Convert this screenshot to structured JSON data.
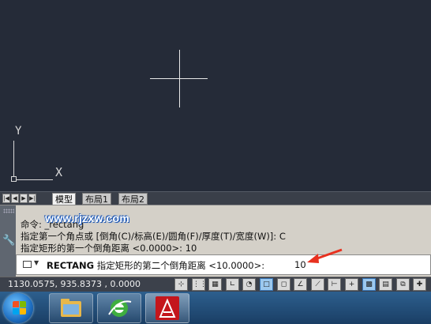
{
  "drawing": {
    "ucs_y_label": "Y",
    "ucs_x_label": "X"
  },
  "layout_tabs": {
    "nav_first": "|◀",
    "nav_prev": "◀",
    "nav_next": "▶",
    "nav_last": "▶|",
    "tabs": [
      {
        "label": "模型",
        "active": true
      },
      {
        "label": "布局1",
        "active": false
      },
      {
        "label": "布局2",
        "active": false
      }
    ]
  },
  "command_window": {
    "watermark": "www.rjzxw.com",
    "history": [
      "命令: _rectang",
      "指定第一个角点或 [倒角(C)/标高(E)/圆角(F)/厚度(T)/宽度(W)]: C",
      "指定矩形的第一个倒角距离 <0.0000>: 10"
    ],
    "prompt_command": "RECTANG",
    "prompt_message": "指定矩形的第二个倒角距离 <10.0000>:",
    "input_value": "10",
    "arrow_color": "#e8311f"
  },
  "status_bar": {
    "coordinates": "1130.0575, 935.8373 , 0.0000",
    "buttons": [
      {
        "name": "infer-constraints-icon",
        "glyph": "⊹",
        "on": false
      },
      {
        "name": "snap-mode-icon",
        "glyph": "⋮⋮",
        "on": false
      },
      {
        "name": "grid-display-icon",
        "glyph": "▦",
        "on": false
      },
      {
        "name": "ortho-mode-icon",
        "glyph": "∟",
        "on": false
      },
      {
        "name": "polar-tracking-icon",
        "glyph": "◔",
        "on": false
      },
      {
        "name": "object-snap-icon",
        "glyph": "□",
        "on": true
      },
      {
        "name": "3d-object-snap-icon",
        "glyph": "◻",
        "on": false
      },
      {
        "name": "object-snap-tracking-icon",
        "glyph": "∠",
        "on": false
      },
      {
        "name": "dynamic-ucs-icon",
        "glyph": "⟋",
        "on": false
      },
      {
        "name": "dynamic-input-icon",
        "glyph": "⊢",
        "on": false
      },
      {
        "name": "lineweight-icon",
        "glyph": "+",
        "on": false
      },
      {
        "name": "transparency-icon",
        "glyph": "▩",
        "on": true
      },
      {
        "name": "quick-properties-icon",
        "glyph": "▤",
        "on": false
      },
      {
        "name": "selection-cycling-icon",
        "glyph": "⧉",
        "on": false
      },
      {
        "name": "annotation-monitor-icon",
        "glyph": "✚",
        "on": false
      }
    ]
  },
  "taskbar": {
    "apps": [
      {
        "name": "file-explorer-icon"
      },
      {
        "name": "browser-icon"
      },
      {
        "name": "autocad-icon"
      }
    ]
  }
}
